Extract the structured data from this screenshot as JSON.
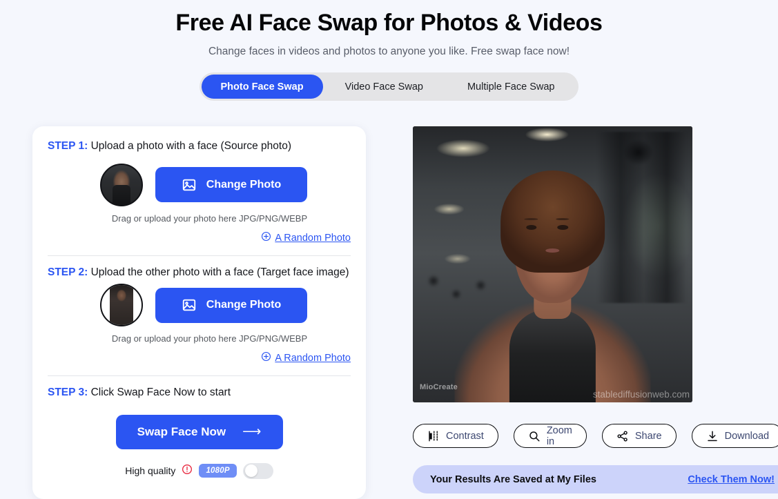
{
  "header": {
    "title": "Free AI Face Swap for Photos & Videos",
    "subtitle": "Change faces in videos and photos to anyone you like. Free swap face now!"
  },
  "tabs": [
    {
      "label": "Photo Face Swap",
      "active": true
    },
    {
      "label": "Video Face Swap",
      "active": false
    },
    {
      "label": "Multiple Face Swap",
      "active": false
    }
  ],
  "steps": {
    "step1": {
      "key": "STEP 1:",
      "text": " Upload a photo with a face (Source photo)",
      "change_photo_label": "Change Photo",
      "hint": "Drag or upload your photo here JPG/PNG/WEBP",
      "random_label": "A Random Photo"
    },
    "step2": {
      "key": "STEP 2:",
      "text": " Upload the other photo with a face (Target face image)",
      "change_photo_label": "Change Photo",
      "hint": "Drag or upload your photo here JPG/PNG/WEBP",
      "random_label": "A Random Photo"
    },
    "step3": {
      "key": "STEP 3:",
      "text": " Click Swap Face Now to start",
      "swap_label": "Swap Face Now",
      "arrow": "⟶",
      "quality_label": "High quality",
      "resolution_badge": "1080P",
      "toggle_state": "off"
    }
  },
  "preview": {
    "watermark_left": "MioCreate",
    "watermark_right": "stablediffusionweb.com"
  },
  "actions": [
    {
      "label": "Contrast",
      "icon": "contrast-icon"
    },
    {
      "label": "Zoom in",
      "icon": "magnifier-icon"
    },
    {
      "label": "Share",
      "icon": "share-icon"
    },
    {
      "label": "Download",
      "icon": "download-icon"
    }
  ],
  "banner": {
    "text": "Your Results Are Saved at My Files",
    "link": "Check Them Now!"
  },
  "colors": {
    "accent_blue": "#2b55f2",
    "page_bg": "#f5f7fd",
    "tab_track": "#e4e4e6",
    "banner_bg": "#ccd3fa",
    "badge_blue": "#6f8ef6",
    "warning_red": "#e8283f"
  }
}
